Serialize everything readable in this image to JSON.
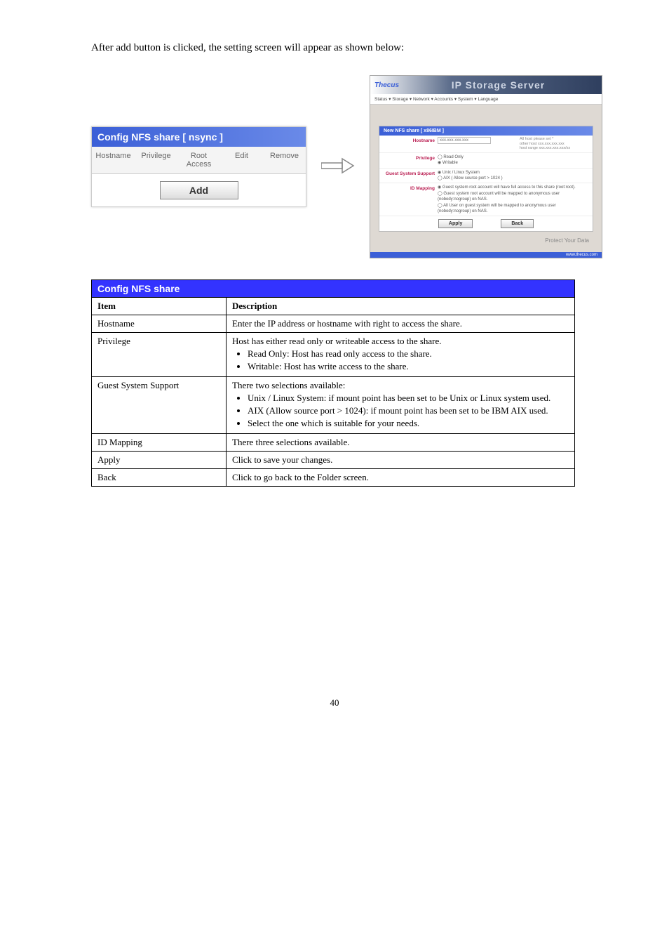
{
  "intro": "After add button is clicked, the setting screen will appear as shown below:",
  "left_panel": {
    "title": "Config NFS share [ nsync ]",
    "cols": [
      "Hostname",
      "Privilege",
      "Root Access",
      "Edit",
      "Remove"
    ],
    "add_label": "Add"
  },
  "right_panel": {
    "logo": "Thecus",
    "banner": "IP Storage Server",
    "menu": "Status ▾   Storage ▾   Network ▾   Accounts ▾   System ▾   Language",
    "form_title": "New NFS share [ x86IBM ]",
    "rows": {
      "hostname_label": "Hostname",
      "hostname_placeholder": "xxx.xxx.xxx.xxx",
      "hostname_hint1": "All host please set *",
      "hostname_hint2": "other host xxx.xxx.xxx.xxx",
      "hostname_hint3": "host range xxx.xxx.xxx.xxx/xx",
      "privilege_label": "Privilege",
      "privilege_opt1": "Read Only",
      "privilege_opt2": "Writable",
      "guest_label": "Guest System Support",
      "guest_opt1": "Unix / Linux System",
      "guest_opt2": "AIX ( Allow source port > 1024 )",
      "idmap_label": "ID Mapping",
      "idmap_opt1": "Guest system root account will have full access to this share (root:root).",
      "idmap_opt2": "Guest system root account will be mapped to anonymous user (nobody:nogroup) on NAS.",
      "idmap_opt3": "All User on guest system will be mapped to anonymous user (nobody:nogroup) on NAS."
    },
    "apply": "Apply",
    "back": "Back",
    "footer_brand": "Protect Your Data",
    "footer_url": "www.thecus.com"
  },
  "table": {
    "header": [
      "Config NFS share",
      ""
    ],
    "col_item": "Item",
    "col_desc": "Description",
    "rows": {
      "hostname_item": "Hostname",
      "hostname_desc": "Enter the IP address or hostname with right to access the share.",
      "priv_item": "Privilege",
      "priv_lead": "Host has either read only or writeable access to the share.",
      "priv_b1": "Read Only: Host has read only access to the share.",
      "priv_b2": "Writable: Host has write access to the share.",
      "guest_item": "Guest System Support",
      "guest_lead": "There two selections available:",
      "guest_b1": "Unix / Linux System: if mount point has been set to be Unix or Linux system used.",
      "guest_b2": "AIX (Allow source port > 1024): if mount point has been set to be IBM AIX used.",
      "guest_b3": "Select the one which is suitable for your needs.",
      "idmap_item": "ID Mapping",
      "idmap_desc": "There three selections available.",
      "apply_item": "Apply",
      "apply_desc": "Click to save your changes.",
      "back_item": "Back",
      "back_desc": "Click to go back to the Folder screen."
    }
  },
  "page_number": "40"
}
